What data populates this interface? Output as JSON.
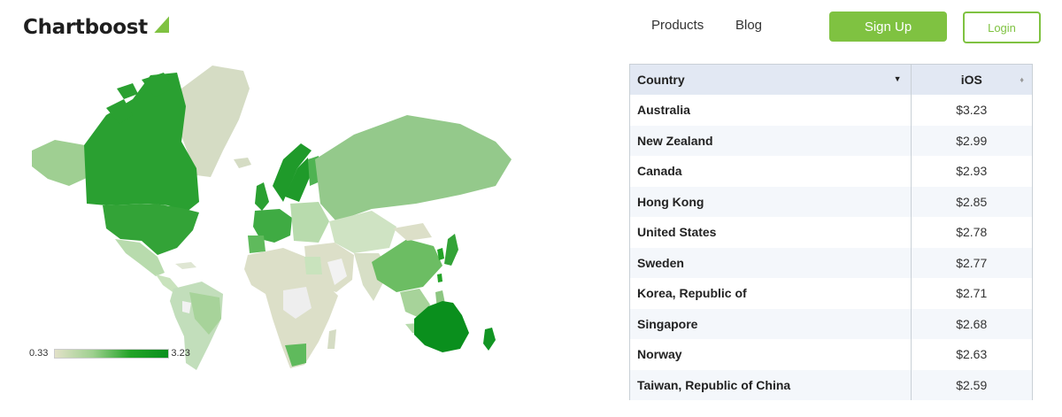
{
  "header": {
    "brand": "Chartboost",
    "nav": {
      "products": "Products",
      "blog": "Blog"
    },
    "signup_label": "Sign Up",
    "login_label": "Login"
  },
  "colors": {
    "accent": "#7fc241",
    "map_high": "#0a8f1d",
    "map_low": "#e2e1c8",
    "table_header_bg": "#e2e8f3"
  },
  "map": {
    "legend_min": "0.33",
    "legend_max": "3.23"
  },
  "table": {
    "headers": {
      "country": "Country",
      "ios": "iOS"
    },
    "rows": [
      {
        "country": "Australia",
        "ios": "$3.23"
      },
      {
        "country": "New Zealand",
        "ios": "$2.99"
      },
      {
        "country": "Canada",
        "ios": "$2.93"
      },
      {
        "country": "Hong Kong",
        "ios": "$2.85"
      },
      {
        "country": "United States",
        "ios": "$2.78"
      },
      {
        "country": "Sweden",
        "ios": "$2.77"
      },
      {
        "country": "Korea, Republic of",
        "ios": "$2.71"
      },
      {
        "country": "Singapore",
        "ios": "$2.68"
      },
      {
        "country": "Norway",
        "ios": "$2.63"
      },
      {
        "country": "Taiwan, Republic of China",
        "ios": "$2.59"
      }
    ]
  }
}
